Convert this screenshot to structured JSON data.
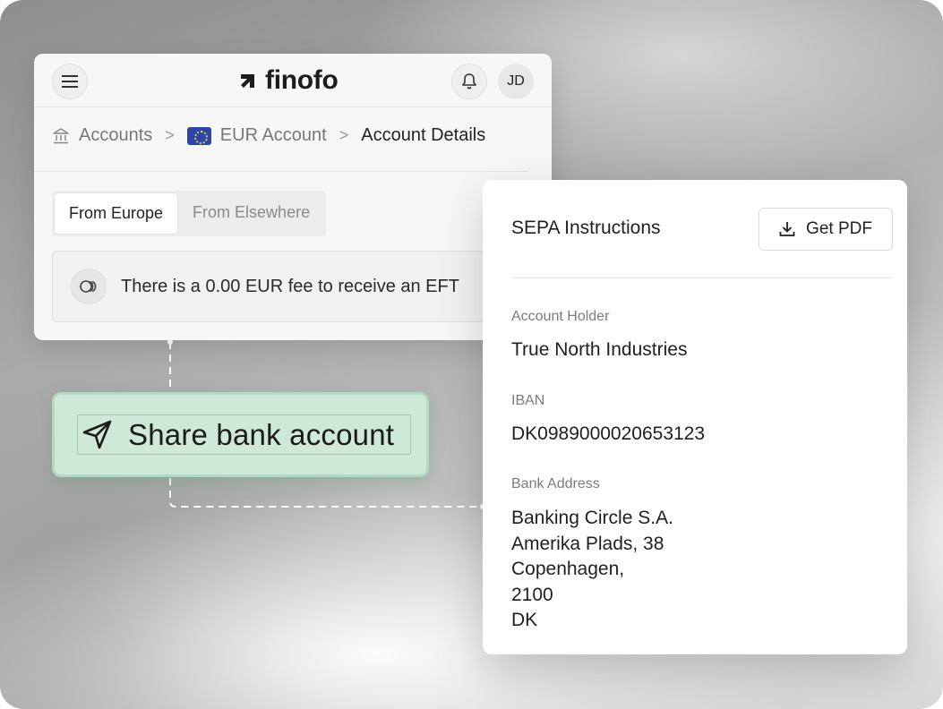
{
  "brand": {
    "name": "finofo"
  },
  "header": {
    "avatar_initials": "JD"
  },
  "breadcrumb": {
    "items": [
      "Accounts",
      "EUR Account",
      "Account Details"
    ],
    "separator": ">"
  },
  "tabs": {
    "items": [
      "From Europe",
      "From Elsewhere"
    ],
    "active": "From Europe"
  },
  "fee": {
    "text": "There is a 0.00 EUR fee to receive an EFT"
  },
  "share": {
    "label": "Share bank account",
    "accent": "#cfe9d8"
  },
  "sepa": {
    "title": "SEPA Instructions",
    "pdf_button": "Get PDF",
    "account_holder_label": "Account Holder",
    "account_holder": "True North Industries",
    "iban_label": "IBAN",
    "iban": "DK0989000020653123",
    "bank_address_label": "Bank Address",
    "bank_address_lines": [
      "Banking Circle S.A.",
      "Amerika Plads, 38",
      "Copenhagen,",
      "2100",
      "DK"
    ]
  },
  "icons": [
    "menu-icon",
    "brand-logo-icon",
    "bell-icon",
    "bank-icon",
    "eu-flag-icon",
    "coins-icon",
    "send-icon",
    "download-icon"
  ]
}
